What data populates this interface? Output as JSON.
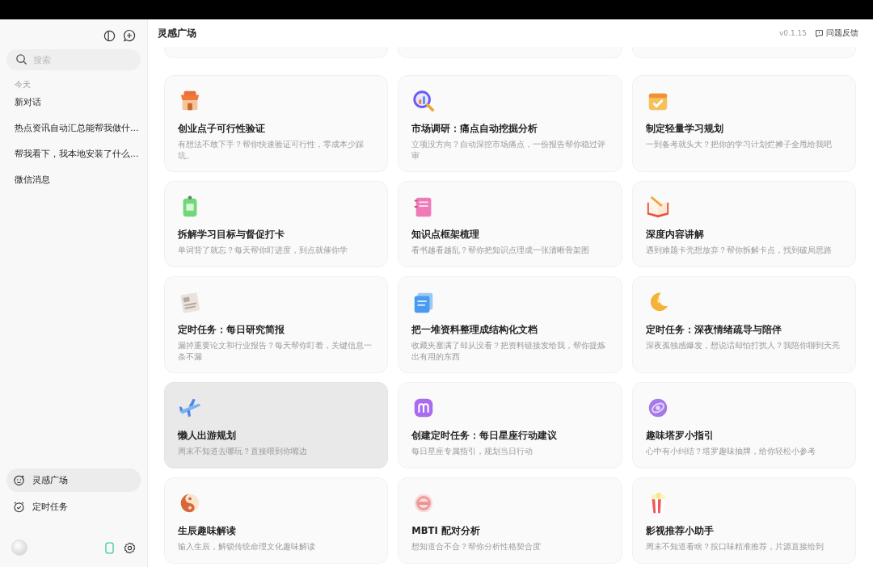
{
  "sidebar": {
    "search": {
      "placeholder": "搜索"
    },
    "section": "今天",
    "chats": [
      {
        "label": "新对话"
      },
      {
        "label": "热点资讯自动汇总能帮我做什..."
      },
      {
        "label": "帮我看下，我本地安装了什么..."
      },
      {
        "label": "微信消息"
      }
    ],
    "nav": [
      {
        "label": "灵感广场",
        "selected": true
      },
      {
        "label": "定时任务",
        "selected": false
      }
    ]
  },
  "header": {
    "title": "灵感广场",
    "version": "v0.1.15",
    "feedback": "问题反馈"
  },
  "cards": [
    {
      "title": "创业点子可行性验证",
      "description": "有想法不敢下手？帮你快速验证可行性，零成本少踩坑。",
      "hovered": false
    },
    {
      "title": "市场调研：痛点自动挖掘分析",
      "description": "立项没方向？自动深挖市场痛点，一份报告帮你稳过评审",
      "hovered": false
    },
    {
      "title": "制定轻量学习规划",
      "description": "一到备考就头大？把你的学习计划烂摊子全甩给我吧",
      "hovered": false
    },
    {
      "title": "拆解学习目标与督促打卡",
      "description": "单词背了就忘？每天帮你盯进度，到点就催你学",
      "hovered": false
    },
    {
      "title": "知识点框架梳理",
      "description": "看书越看越乱？帮你把知识点理成一张清晰骨架图",
      "hovered": false
    },
    {
      "title": "深度内容讲解",
      "description": "遇到难题卡壳想放弃？帮你拆解卡点，找到破局思路",
      "hovered": false
    },
    {
      "title": "定时任务：每日研究简报",
      "description": "漏掉重要论文和行业报告？每天帮你盯着，关键信息一条不漏",
      "hovered": false
    },
    {
      "title": "把一堆资料整理成结构化文档",
      "description": "收藏夹塞满了却从没看？把资料链接发给我，帮你提炼出有用的东西",
      "hovered": false
    },
    {
      "title": "定时任务：深夜情绪疏导与陪伴",
      "description": "深夜孤独感爆发，想说话却怕打扰人？我陪你聊到天亮",
      "hovered": false
    },
    {
      "title": "懒人出游规划",
      "description": "周末不知道去哪玩？直接喂到你嘴边",
      "hovered": true
    },
    {
      "title": "创建定时任务：每日星座行动建议",
      "description": "每日星座专属指引，规划当日行动",
      "hovered": false
    },
    {
      "title": "趣味塔罗小指引",
      "description": "心中有小纠结？塔罗趣味抽牌，给你轻松小参考",
      "hovered": false
    },
    {
      "title": "生辰趣味解读",
      "description": "输入生辰，解锁传统命理文化趣味解读",
      "hovered": false
    },
    {
      "title": "MBTI 配对分析",
      "description": "想知道合不合？帮你分析性格契合度",
      "hovered": false
    },
    {
      "title": "影视推荐小助手",
      "description": "周末不知道看啥？按口味精准推荐，片源直接给到",
      "hovered": false
    }
  ]
}
